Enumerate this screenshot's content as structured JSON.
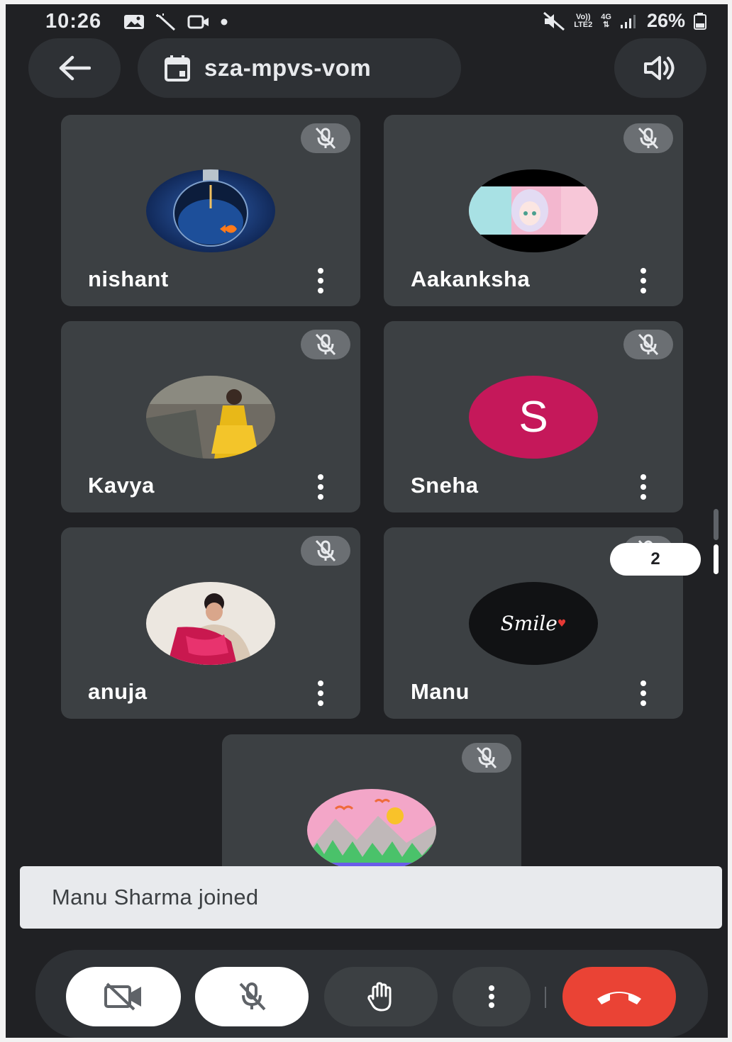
{
  "status_bar": {
    "time": "10:26",
    "network_line1": "Vo))",
    "network_line2": "LTE2",
    "data_type": "4G",
    "battery": "26%"
  },
  "top_bar": {
    "meeting_code": "sza-mpvs-vom"
  },
  "participants": [
    {
      "name": "nishant",
      "avatar": "lightbulb-photo",
      "muted": true
    },
    {
      "name": "Aakanksha",
      "avatar": "anime-photo",
      "muted": true
    },
    {
      "name": "Kavya",
      "avatar": "person-photo",
      "muted": true
    },
    {
      "name": "Sneha",
      "avatar_letter": "S",
      "avatar_color": "#c5185a",
      "muted": true
    },
    {
      "name": "anuja",
      "avatar": "person-photo",
      "muted": true
    },
    {
      "name": "Manu",
      "avatar_text": "Smile",
      "muted": true
    },
    {
      "name": "",
      "avatar": "landscape-illustration",
      "muted": true
    }
  ],
  "page_indicator": "2",
  "toast": {
    "message": "Manu Sharma joined"
  },
  "controls": {
    "camera": "camera-off-icon",
    "mic": "mic-off-icon",
    "raise_hand": "hand-icon",
    "more": "more-vert-icon",
    "end_call": "end-call-icon"
  },
  "colors": {
    "background": "#202124",
    "tile": "#3c4043",
    "end_call": "#ea4335",
    "avatar_sneha": "#c5185a"
  }
}
